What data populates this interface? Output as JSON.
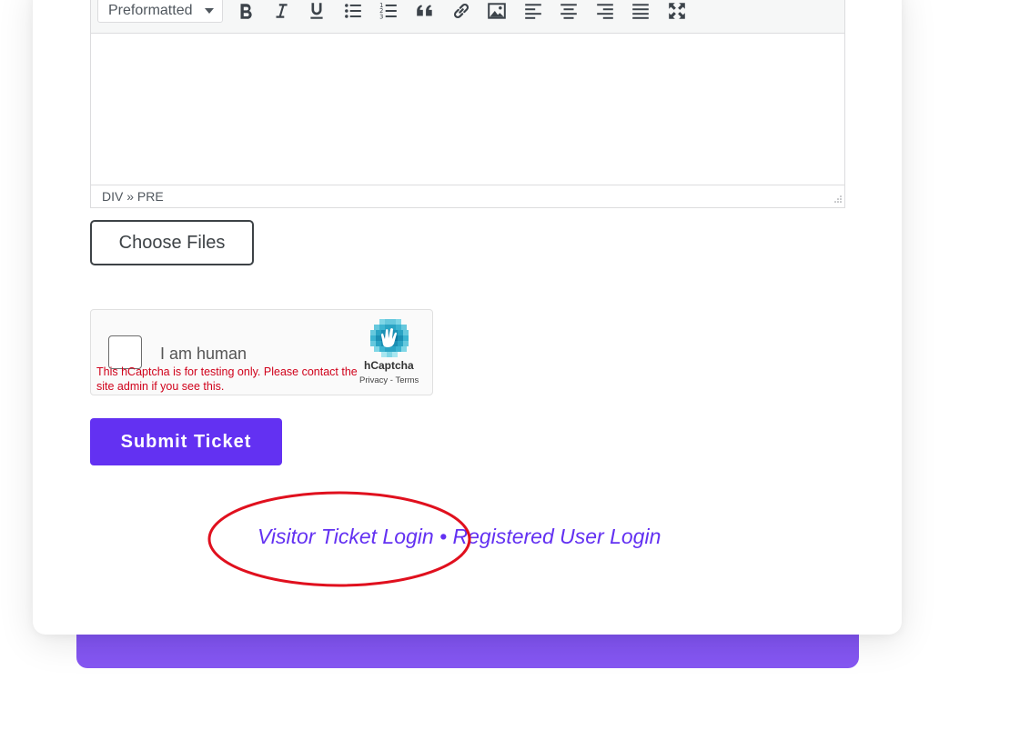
{
  "editor": {
    "format_select": "Preformatted",
    "status_path": "DIV » PRE",
    "toolbar": [
      {
        "icon": "bold-icon"
      },
      {
        "icon": "italic-icon"
      },
      {
        "icon": "underline-icon"
      },
      {
        "icon": "bullet-list-icon"
      },
      {
        "icon": "numbered-list-icon"
      },
      {
        "icon": "blockquote-icon"
      },
      {
        "icon": "link-icon"
      },
      {
        "icon": "image-icon"
      },
      {
        "icon": "align-left-icon"
      },
      {
        "icon": "align-center-icon"
      },
      {
        "icon": "align-right-icon"
      },
      {
        "icon": "align-justify-icon"
      },
      {
        "icon": "fullscreen-icon"
      }
    ]
  },
  "attachments": {
    "choose_files_label": "Choose Files"
  },
  "captcha": {
    "checkbox_label": "I am human",
    "warning": "This hCaptcha is for testing only. Please contact the site admin if you see this.",
    "brand": "hCaptcha",
    "privacy": "Privacy",
    "separator": " - ",
    "terms": "Terms"
  },
  "submit": {
    "label": "Submit Ticket"
  },
  "login_links": {
    "visitor": "Visitor Ticket Login",
    "separator": " • ",
    "registered": "Registered User Login"
  },
  "colors": {
    "accent": "#6331f2",
    "annotation": "#e0101e",
    "captcha_warning": "#d0021b"
  }
}
